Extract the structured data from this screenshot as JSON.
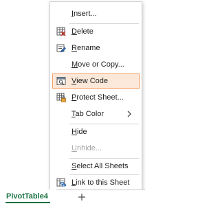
{
  "context_menu": {
    "items": [
      {
        "label": "Insert...",
        "accel": "I",
        "enabled": true,
        "highlighted": false,
        "icon": "none"
      },
      {
        "label": "Delete",
        "accel": "D",
        "enabled": true,
        "highlighted": false,
        "icon": "delete-sheet-icon"
      },
      {
        "label": "Rename",
        "accel": "R",
        "enabled": true,
        "highlighted": false,
        "icon": "rename-icon"
      },
      {
        "label": "Move or Copy...",
        "accel": "M",
        "enabled": true,
        "highlighted": false,
        "icon": "none"
      },
      {
        "label": "View Code",
        "accel": "V",
        "enabled": true,
        "highlighted": true,
        "icon": "view-code-icon"
      },
      {
        "label": "Protect Sheet...",
        "accel": "P",
        "enabled": true,
        "highlighted": false,
        "icon": "protect-sheet-icon"
      },
      {
        "label": "Tab Color",
        "accel": "T",
        "enabled": true,
        "highlighted": false,
        "icon": "none",
        "submenu": true
      },
      {
        "label": "Hide",
        "accel": "H",
        "enabled": true,
        "highlighted": false,
        "icon": "none"
      },
      {
        "label": "Unhide...",
        "accel": "U",
        "enabled": false,
        "highlighted": false,
        "icon": "none"
      },
      {
        "label": "Select All Sheets",
        "accel": "S",
        "enabled": true,
        "highlighted": false,
        "icon": "none"
      },
      {
        "label": "Link to this Sheet",
        "accel": "L",
        "enabled": true,
        "highlighted": false,
        "icon": "link-sheet-icon"
      }
    ],
    "submenu_arrow": "chevron-right-icon"
  },
  "sheet_tabs": {
    "active_tab": "PivotTable4",
    "add_sheet": "plus-icon"
  },
  "colors": {
    "highlight_fill": "#fbe8d9",
    "highlight_border": "#f2a06a",
    "active_tab_text": "#1a7343",
    "disabled_text": "#a6a6a6"
  }
}
